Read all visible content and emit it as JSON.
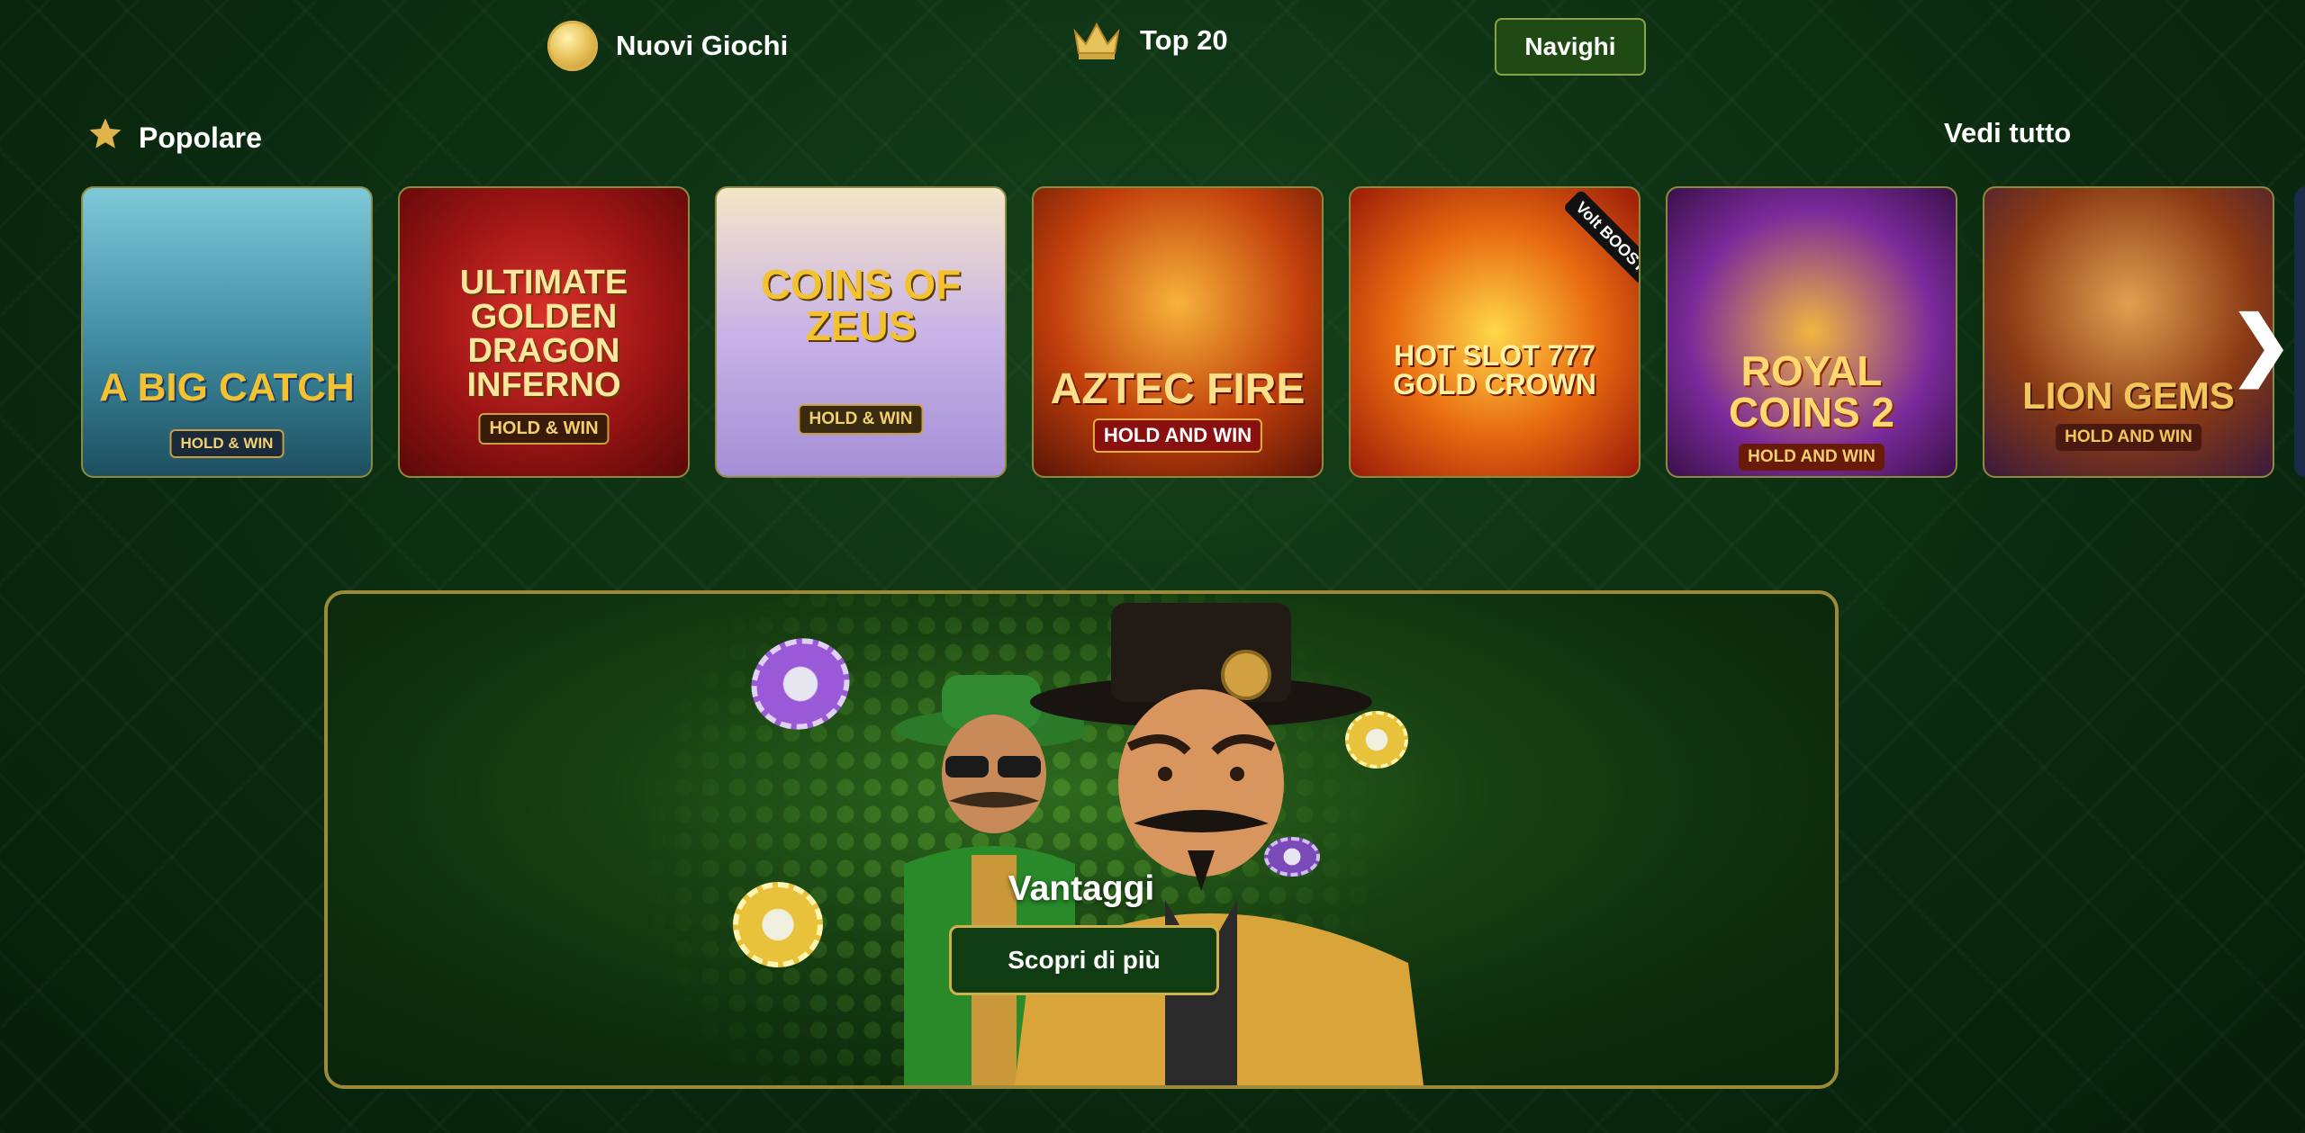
{
  "nav": {
    "new_games_label": "Nuovi Giochi",
    "top20_label": "Top 20",
    "browse_label": "Navighi"
  },
  "popular": {
    "title": "Popolare",
    "view_all": "Vedi tutto",
    "games": [
      {
        "title": "A BIG CATCH",
        "tag": "HOLD & WIN"
      },
      {
        "title": "ULTIMATE GOLDEN DRAGON INFERNO",
        "tag": "HOLD & WIN"
      },
      {
        "title": "COINS OF ZEUS",
        "tag": "HOLD & WIN"
      },
      {
        "title": "AZTEC FIRE",
        "tag": "HOLD AND WIN"
      },
      {
        "title": "HOT SLOT 777 GOLD CROWN",
        "tag": "Volt BOOST"
      },
      {
        "title": "ROYAL COINS 2",
        "tag": "HOLD AND WIN"
      },
      {
        "title": "LION GEMS",
        "tag": "HOLD AND WIN"
      }
    ]
  },
  "banner": {
    "title": "Vantaggi",
    "button_label": "Scopri di più"
  },
  "colors": {
    "background": "#0b2a10",
    "accent_gold": "#d1b04a",
    "button_green": "#103c14"
  }
}
